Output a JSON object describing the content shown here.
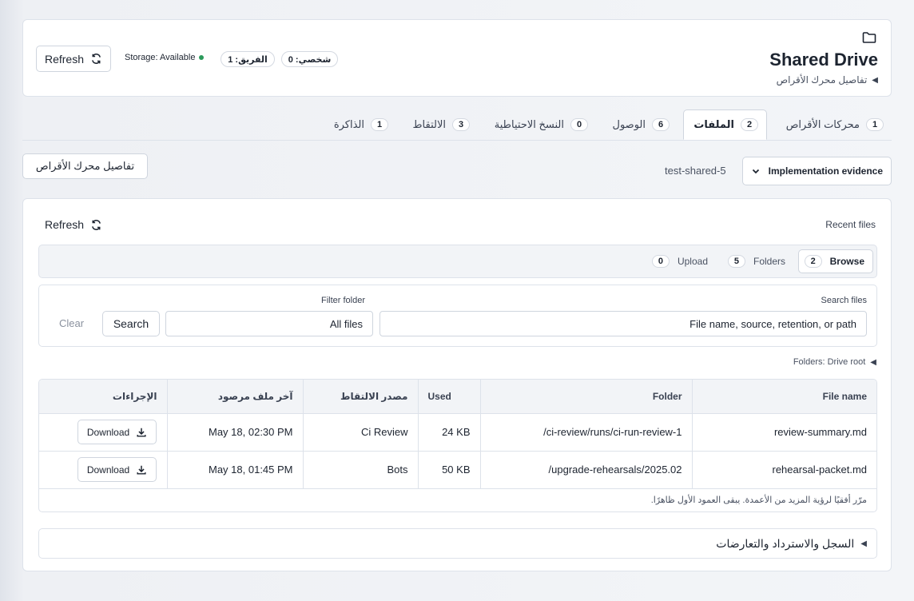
{
  "header": {
    "title": "Shared Drive",
    "subtitle": "تفاصيل محرك الأقراص",
    "refresh_label": "Refresh",
    "storage_label": "Storage: Available",
    "team_pill": "الفريق: 1",
    "personal_pill": "شخصي: 0"
  },
  "tabs": [
    {
      "label": "محركات الأقراص",
      "count": "1"
    },
    {
      "label": "الملفات",
      "count": "2"
    },
    {
      "label": "الوصول",
      "count": "6"
    },
    {
      "label": "النسخ الاحتياطية",
      "count": "0"
    },
    {
      "label": "الالتقاط",
      "count": "3"
    },
    {
      "label": "الذاكرة",
      "count": "1"
    }
  ],
  "drive": {
    "details_button": "تفاصيل محرك الأقراص",
    "name": "test-shared-5",
    "evidence_select": "Implementation evidence"
  },
  "files": {
    "recent_label": "Recent files",
    "refresh_label": "Refresh",
    "subtabs": [
      {
        "label": "Browse",
        "count": "2"
      },
      {
        "label": "Folders",
        "count": "5"
      },
      {
        "label": "Upload",
        "count": "0"
      }
    ],
    "search_label": "Search files",
    "search_placeholder": "File name, source, retention, or path",
    "filter_label": "Filter folder",
    "filter_value": "All files",
    "search_button": "Search",
    "clear_button": "Clear",
    "folders_crumb": "Folders: Drive root",
    "columns": [
      "File name",
      "Folder",
      "Used",
      "مصدر الالتقاط",
      "آخر ملف مرصود",
      "الإجراءات"
    ],
    "rows": [
      {
        "name": "review-summary.md",
        "folder": "/ci-review/runs/ci-run-review-1",
        "used": "24 KB",
        "source": "Ci Review",
        "last": "May 18, 02:30 PM",
        "action": "Download"
      },
      {
        "name": "rehearsal-packet.md",
        "folder": "/upgrade-rehearsals/2025.02",
        "used": "50 KB",
        "source": "Bots",
        "last": "May 18, 01:45 PM",
        "action": "Download"
      }
    ],
    "scroll_hint": "مرّر أفقيًا لرؤية المزيد من الأعمدة. يبقى العمود الأول ظاهرًا.",
    "log_section": "السجل والاسترداد والتعارضات"
  },
  "colors": {
    "accent": "#2b9a5b",
    "border": "#dde2ea"
  },
  "icons": [
    "folder-icon",
    "refresh-icon",
    "download-icon",
    "chevron-down-icon",
    "caret-left-icon"
  ]
}
